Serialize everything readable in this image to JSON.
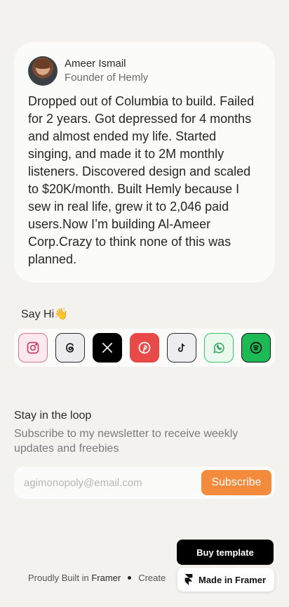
{
  "profile": {
    "name": "Ameer Ismail",
    "role": "Founder of Hemly",
    "bio": "Dropped out of Columbia to build. Failed for 2 years. Got depressed for 4 months and almost ended my life. Started singing, and made it to 2M monthly listeners. Discovered design and scaled to $20K/month. Built Hemly because I sew in real life, grew it to 2,046 paid users.Now I’m building Al-Ameer Corp.Crazy to think none of this was planned."
  },
  "say_hi": {
    "label": "Say Hi",
    "emoji": "👋",
    "socials": [
      {
        "name": "instagram-icon"
      },
      {
        "name": "threads-icon"
      },
      {
        "name": "x-icon"
      },
      {
        "name": "pinterest-icon"
      },
      {
        "name": "tiktok-icon"
      },
      {
        "name": "whatsapp-icon"
      },
      {
        "name": "spotify-icon"
      }
    ]
  },
  "newsletter": {
    "title": "Stay in the loop",
    "description": "Subscribe to my newsletter to receive weekly updates and freebies",
    "placeholder": "agimonopoly@email.com",
    "button": "Subscribe"
  },
  "footer": {
    "buy_template": "Buy template",
    "built_prefix": "Proudly Built in ",
    "built_brand": "Framer",
    "created": "Create",
    "made_in_framer": "Made in Framer"
  },
  "colors": {
    "background": "#f3f2ee",
    "accent": "#f48a3c"
  }
}
